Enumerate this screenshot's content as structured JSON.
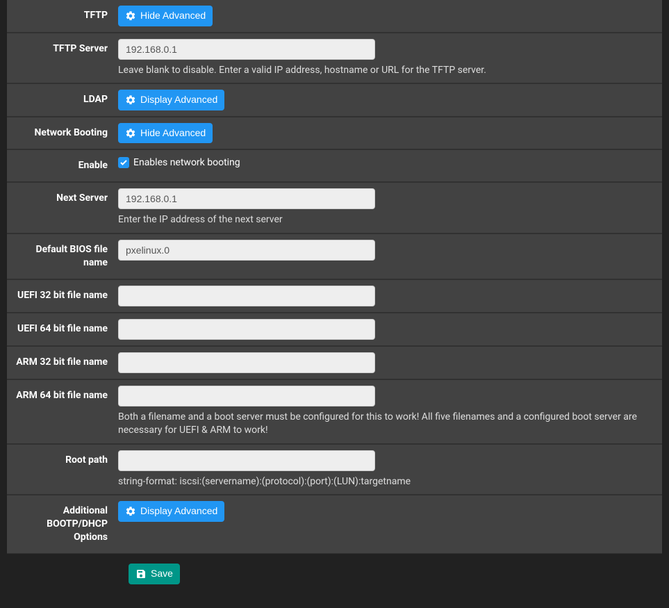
{
  "rows": {
    "tftp": {
      "label": "TFTP",
      "button": "Hide Advanced"
    },
    "tftp_server": {
      "label": "TFTP Server",
      "value": "192.168.0.1",
      "help": "Leave blank to disable. Enter a valid IP address, hostname or URL for the TFTP server."
    },
    "ldap": {
      "label": "LDAP",
      "button": "Display Advanced"
    },
    "netboot": {
      "label": "Network Booting",
      "button": "Hide Advanced"
    },
    "enable": {
      "label": "Enable",
      "checkbox_label": "Enables network booting"
    },
    "next_server": {
      "label": "Next Server",
      "value": "192.168.0.1",
      "help": "Enter the IP address of the next server"
    },
    "default_bios": {
      "label": "Default BIOS file name",
      "value": "pxelinux.0"
    },
    "uefi32": {
      "label": "UEFI 32 bit file name",
      "value": ""
    },
    "uefi64": {
      "label": "UEFI 64 bit file name",
      "value": ""
    },
    "arm32": {
      "label": "ARM 32 bit file name",
      "value": ""
    },
    "arm64": {
      "label": "ARM 64 bit file name",
      "value": "",
      "help": "Both a filename and a boot server must be configured for this to work! All five filenames and a configured boot server are necessary for UEFI & ARM to work!"
    },
    "root_path": {
      "label": "Root path",
      "value": "",
      "help": "string-format: iscsi:(servername):(protocol):(port):(LUN):targetname"
    },
    "bootp": {
      "label": "Additional BOOTP/DHCP Options",
      "button": "Display Advanced"
    }
  },
  "save_button": "Save"
}
